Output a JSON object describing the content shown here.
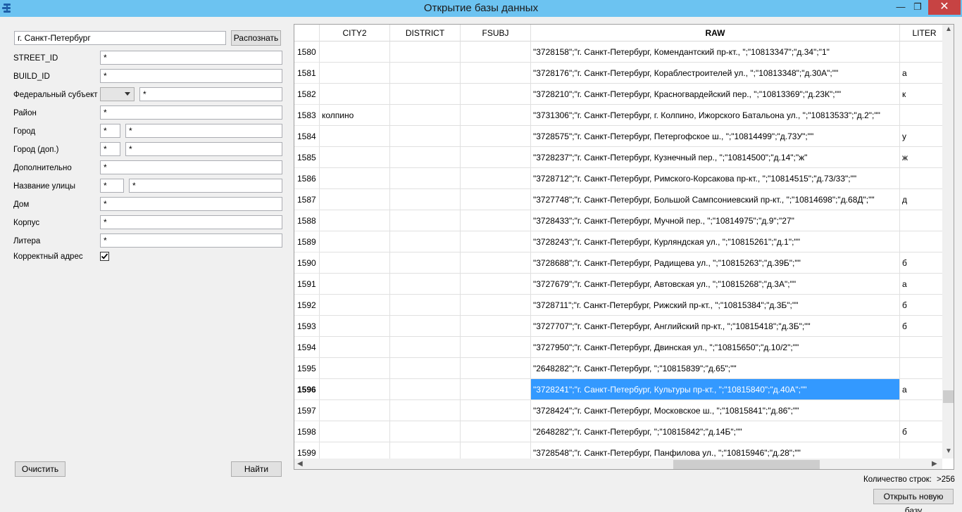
{
  "window": {
    "title": "Открытие базы данных",
    "minimize": "—",
    "maximize": "❐",
    "close": "✕"
  },
  "search": {
    "query": "г. Санкт-Петербург",
    "recognize_label": "Распознать"
  },
  "form": {
    "street_id": {
      "label": "STREET_ID",
      "value": "*"
    },
    "build_id": {
      "label": "BUILD_ID",
      "value": "*"
    },
    "fed_subject": {
      "label": "Федеральный субъект",
      "combo_value": "",
      "value": "*"
    },
    "district": {
      "label": "Район",
      "value": "*"
    },
    "city": {
      "label": "Город",
      "value1": "*",
      "value2": "*"
    },
    "city_extra": {
      "label": "Город (доп.)",
      "value1": "*",
      "value2": "*"
    },
    "additional": {
      "label": "Дополнительно",
      "value": "*"
    },
    "street_name": {
      "label": "Название улицы",
      "value1": "*",
      "value2": "*"
    },
    "house": {
      "label": "Дом",
      "value": "*"
    },
    "building": {
      "label": "Корпус",
      "value": "*"
    },
    "liter": {
      "label": "Литера",
      "value": "*"
    },
    "correct_address": {
      "label": "Корректный адрес",
      "checked": true
    }
  },
  "buttons": {
    "clear": "Очистить",
    "find": "Найти",
    "open_new": "Открыть новую базу"
  },
  "table": {
    "columns": [
      "CITY2",
      "DISTRICT",
      "FSUBJ",
      "RAW",
      "LITER"
    ],
    "sorted_column": "RAW",
    "rows": [
      {
        "n": "1580",
        "city2": "",
        "district": "",
        "fsubj": "",
        "raw": "\"3728158\";\"г. Санкт-Петербург, Комендантский пр-кт., \";\"10813347\";\"д.34\";\"1\"",
        "liter": "",
        "selected": false
      },
      {
        "n": "1581",
        "city2": "",
        "district": "",
        "fsubj": "",
        "raw": "\"3728176\";\"г. Санкт-Петербург, Кораблестроителей ул., \";\"10813348\";\"д.30А\";\"\"",
        "liter": "а",
        "selected": false
      },
      {
        "n": "1582",
        "city2": "",
        "district": "",
        "fsubj": "",
        "raw": "\"3728210\";\"г. Санкт-Петербург, Красногвардейский пер., \";\"10813369\";\"д.23К\";\"\"",
        "liter": "к",
        "selected": false
      },
      {
        "n": "1583",
        "city2": "колпино",
        "district": "",
        "fsubj": "",
        "raw": "\"3731306\";\"г. Санкт-Петербург, г. Колпино, Ижорского Батальона ул., \";\"10813533\";\"д.2\";\"\"",
        "liter": "",
        "selected": false
      },
      {
        "n": "1584",
        "city2": "",
        "district": "",
        "fsubj": "",
        "raw": "\"3728575\";\"г. Санкт-Петербург, Петергофское ш., \";\"10814499\";\"д.73У\";\"\"",
        "liter": "у",
        "selected": false
      },
      {
        "n": "1585",
        "city2": "",
        "district": "",
        "fsubj": "",
        "raw": "\"3728237\";\"г. Санкт-Петербург, Кузнечный пер., \";\"10814500\";\"д.14\";\"ж\"",
        "liter": "ж",
        "selected": false
      },
      {
        "n": "1586",
        "city2": "",
        "district": "",
        "fsubj": "",
        "raw": "\"3728712\";\"г. Санкт-Петербург, Римского-Корсакова пр-кт., \";\"10814515\";\"д.73/33\";\"\"",
        "liter": "",
        "selected": false
      },
      {
        "n": "1587",
        "city2": "",
        "district": "",
        "fsubj": "",
        "raw": "\"3727748\";\"г. Санкт-Петербург, Большой Сампсониевский пр-кт., \";\"10814698\";\"д.68Д\";\"\"",
        "liter": "д",
        "selected": false
      },
      {
        "n": "1588",
        "city2": "",
        "district": "",
        "fsubj": "",
        "raw": "\"3728433\";\"г. Санкт-Петербург, Мучной пер., \";\"10814975\";\"д.9\";\"27\"",
        "liter": "",
        "selected": false
      },
      {
        "n": "1589",
        "city2": "",
        "district": "",
        "fsubj": "",
        "raw": "\"3728243\";\"г. Санкт-Петербург, Курляндская ул., \";\"10815261\";\"д.1\";\"\"",
        "liter": "",
        "selected": false
      },
      {
        "n": "1590",
        "city2": "",
        "district": "",
        "fsubj": "",
        "raw": "\"3728688\";\"г. Санкт-Петербург, Радищева ул., \";\"10815263\";\"д.39Б\";\"\"",
        "liter": "б",
        "selected": false
      },
      {
        "n": "1591",
        "city2": "",
        "district": "",
        "fsubj": "",
        "raw": "\"3727679\";\"г. Санкт-Петербург, Автовская ул., \";\"10815268\";\"д.3А\";\"\"",
        "liter": "а",
        "selected": false
      },
      {
        "n": "1592",
        "city2": "",
        "district": "",
        "fsubj": "",
        "raw": "\"3728711\";\"г. Санкт-Петербург, Рижский пр-кт., \";\"10815384\";\"д.3Б\";\"\"",
        "liter": "б",
        "selected": false
      },
      {
        "n": "1593",
        "city2": "",
        "district": "",
        "fsubj": "",
        "raw": "\"3727707\";\"г. Санкт-Петербург, Английский пр-кт., \";\"10815418\";\"д.3Б\";\"\"",
        "liter": "б",
        "selected": false
      },
      {
        "n": "1594",
        "city2": "",
        "district": "",
        "fsubj": "",
        "raw": "\"3727950\";\"г. Санкт-Петербург, Двинская ул., \";\"10815650\";\"д.10/2\";\"\"",
        "liter": "",
        "selected": false
      },
      {
        "n": "1595",
        "city2": "",
        "district": "",
        "fsubj": "",
        "raw": "\"2648282\";\"г. Санкт-Петербург, \";\"10815839\";\"д.65\";\"\"",
        "liter": "",
        "selected": false
      },
      {
        "n": "1596",
        "city2": "",
        "district": "",
        "fsubj": "",
        "raw": "\"3728241\";\"г. Санкт-Петербург, Культуры пр-кт., \";\"10815840\";\"д.40А\";\"\"",
        "liter": "а",
        "selected": true
      },
      {
        "n": "1597",
        "city2": "",
        "district": "",
        "fsubj": "",
        "raw": "\"3728424\";\"г. Санкт-Петербург, Московское ш., \";\"10815841\";\"д.86\";\"\"",
        "liter": "",
        "selected": false
      },
      {
        "n": "1598",
        "city2": "",
        "district": "",
        "fsubj": "",
        "raw": "\"2648282\";\"г. Санкт-Петербург, \";\"10815842\";\"д.14Б\";\"\"",
        "liter": "б",
        "selected": false
      },
      {
        "n": "1599",
        "city2": "",
        "district": "",
        "fsubj": "",
        "raw": "\"3728548\";\"г. Санкт-Петербург, Панфилова ул., \";\"10815946\";\"д.28\";\"\"",
        "liter": "",
        "selected": false
      }
    ]
  },
  "footer": {
    "row_count_label": "Количество строк:",
    "row_count_value": ">256"
  },
  "colors": {
    "titlebar": "#6cc3f1",
    "selection": "#3399ff",
    "close_button": "#c74343"
  }
}
